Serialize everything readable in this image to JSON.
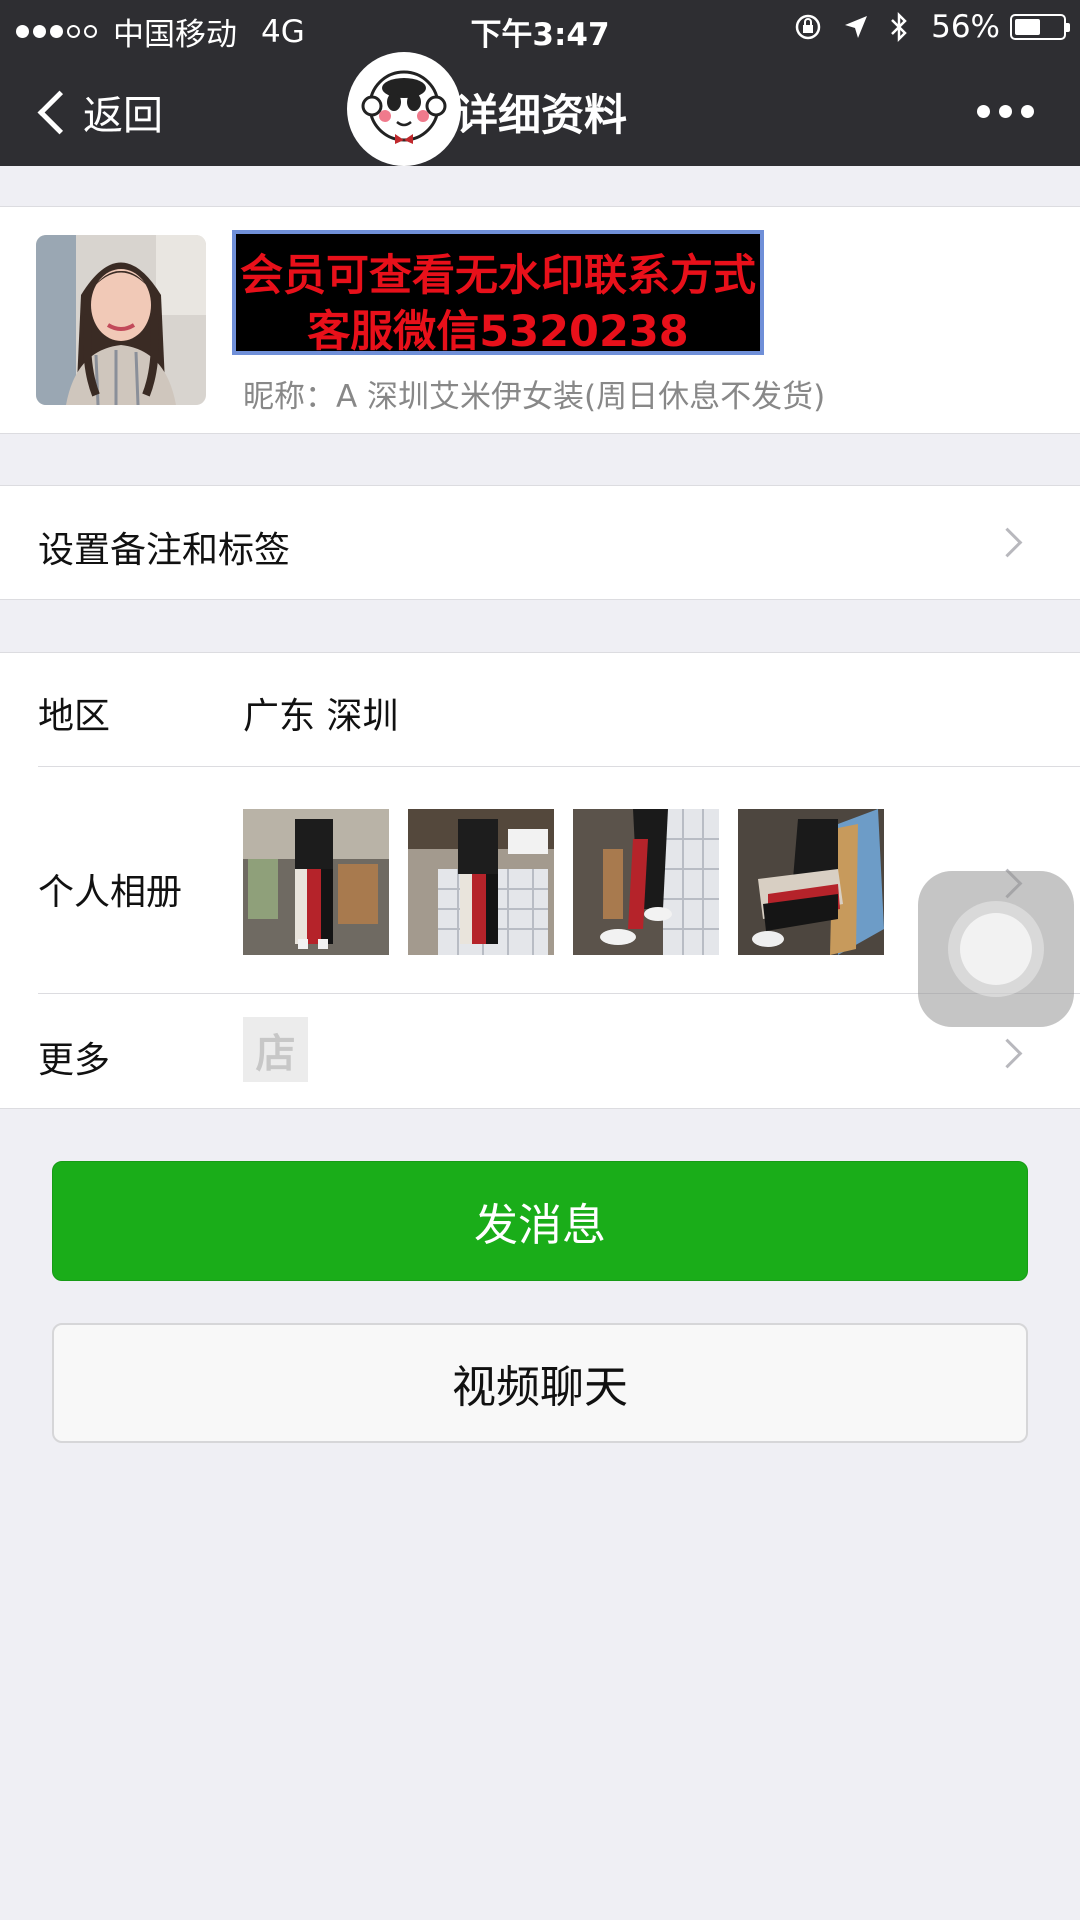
{
  "status_bar": {
    "carrier": "中国移动",
    "network": "4G",
    "time": "下午3:47",
    "battery_percent": "56%",
    "battery_level": 0.56,
    "icons": [
      "orientation-lock-icon",
      "location-arrow-icon",
      "bluetooth-icon"
    ]
  },
  "nav": {
    "back_label": "返回",
    "title": "详细资料",
    "more_icon": "more-dots-icon"
  },
  "profile": {
    "banner_line1": "会员可查看无水印联系方式",
    "banner_line2": "客服微信5320238",
    "nickname": "昵称：A 深圳艾米伊女装(周日休息不发货)"
  },
  "remark": {
    "label": "设置备注和标签"
  },
  "info": {
    "region_label": "地区",
    "region_value": "广东 深圳",
    "album_label": "个人相册",
    "more_label": "更多",
    "shop_icon_text": "店"
  },
  "actions": {
    "send_message": "发消息",
    "video_chat": "视频聊天"
  },
  "colors": {
    "nav_bg": "#2e2e32",
    "primary_button": "#1aad19",
    "page_bg": "#efeff4",
    "banner_text": "#e8101a"
  }
}
